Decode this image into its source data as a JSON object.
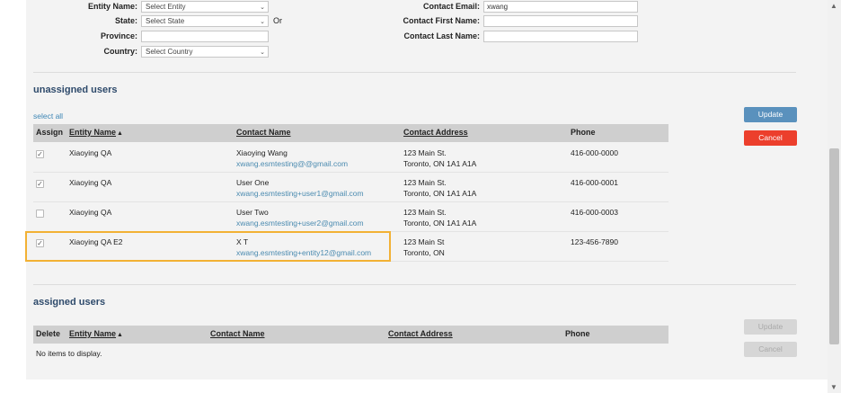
{
  "filters": {
    "entity_name": {
      "label": "Entity Name:",
      "value": "Select Entity"
    },
    "state": {
      "label": "State:",
      "value": "Select State"
    },
    "or_text": "Or",
    "province": {
      "label": "Province:",
      "value": ""
    },
    "country": {
      "label": "Country:",
      "value": "Select Country"
    },
    "contact_email": {
      "label": "Contact Email:",
      "value": "xwang"
    },
    "contact_first_name": {
      "label": "Contact First Name:",
      "value": ""
    },
    "contact_last_name": {
      "label": "Contact Last Name:",
      "value": ""
    }
  },
  "unassigned": {
    "title": "unassigned users",
    "select_all": "select all",
    "columns": {
      "assign": "Assign",
      "entity": "Entity Name",
      "contact": "Contact Name",
      "address": "Contact Address",
      "phone": "Phone"
    },
    "sort_glyph": "▲",
    "rows": [
      {
        "checked": true,
        "entity": "Xiaoying QA",
        "contact": "Xiaoying Wang",
        "email": "xwang.esmtesting@@gmail.com",
        "addr1": "123 Main St.",
        "addr2": "Toronto, ON 1A1 A1A",
        "phone": "416-000-0000"
      },
      {
        "checked": true,
        "entity": "Xiaoying QA",
        "contact": "User One",
        "email": "xwang.esmtesting+user1@gmail.com",
        "addr1": "123 Main St.",
        "addr2": "Toronto, ON 1A1 A1A",
        "phone": "416-000-0001"
      },
      {
        "checked": false,
        "entity": "Xiaoying QA",
        "contact": "User Two",
        "email": "xwang.esmtesting+user2@gmail.com",
        "addr1": "123 Main St.",
        "addr2": "Toronto, ON 1A1 A1A",
        "phone": "416-000-0003"
      },
      {
        "checked": true,
        "entity": "Xiaoying QA E2",
        "contact": "X T",
        "email": "xwang.esmtesting+entity12@gmail.com",
        "addr1": "123 Main St",
        "addr2": "Toronto, ON",
        "phone": "123-456-7890"
      }
    ],
    "update_label": "Update",
    "cancel_label": "Cancel"
  },
  "assigned": {
    "title": "assigned users",
    "columns": {
      "delete": "Delete",
      "entity": "Entity Name",
      "contact": "Contact Name",
      "address": "Contact Address",
      "phone": "Phone"
    },
    "sort_glyph": "▲",
    "empty_text": "No items to display.",
    "update_label": "Update",
    "cancel_label": "Cancel"
  },
  "colors": {
    "accent": "#5a91bd",
    "danger": "#ec3f2c",
    "highlight": "#f2b134",
    "section_title": "#2e4a6b"
  }
}
